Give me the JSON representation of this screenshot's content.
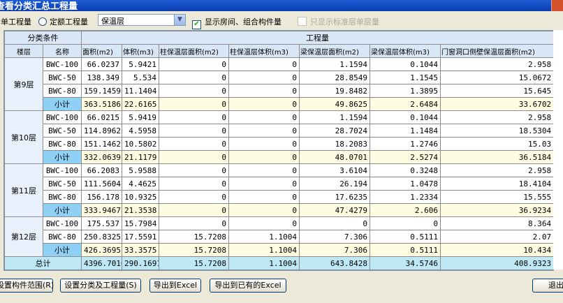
{
  "window": {
    "title": "查看分类汇总工程量"
  },
  "toolbar": {
    "radio1": "清单工程量",
    "radio2": "定额工程量",
    "select_value": "保温层",
    "check1": "显示房间、组合构件量",
    "check2": "只显示标准层单层量"
  },
  "table": {
    "group_left": "分类条件",
    "group_right": "工程量",
    "columns": [
      "楼层",
      "名称",
      "面积(m2)",
      "体积(m3)",
      "柱保温层面积(m2)",
      "柱保温层体积(m3)",
      "梁保温层面积(m2)",
      "梁保温层体积(m3)",
      "门窗洞口侧壁保温层面积(m2)"
    ],
    "subtotal_label": "小计",
    "total_label": "总计",
    "floors": [
      {
        "floor": "第9层",
        "rows": [
          [
            "BWC-100",
            "66.0237",
            "5.9421",
            "0",
            "0",
            "1.1594",
            "0.1044",
            "2.958"
          ],
          [
            "BWC-50",
            "138.349",
            "5.534",
            "0",
            "0",
            "28.8549",
            "1.1545",
            "15.0672"
          ],
          [
            "BWC-80",
            "159.1459",
            "11.1404",
            "0",
            "0",
            "19.8482",
            "1.3895",
            "15.645"
          ]
        ],
        "subtotal": [
          "363.5186",
          "22.6165",
          "0",
          "0",
          "49.8625",
          "2.6484",
          "33.6702"
        ]
      },
      {
        "floor": "第10层",
        "rows": [
          [
            "BWC-100",
            "66.0215",
            "5.9419",
            "0",
            "0",
            "1.1594",
            "0.1044",
            "2.958"
          ],
          [
            "BWC-50",
            "114.8962",
            "4.5958",
            "0",
            "0",
            "28.7024",
            "1.1484",
            "18.5304"
          ],
          [
            "BWC-80",
            "151.1462",
            "10.5802",
            "0",
            "0",
            "18.2083",
            "1.2746",
            "15.03"
          ]
        ],
        "subtotal": [
          "332.0639",
          "21.1179",
          "0",
          "0",
          "48.0701",
          "2.5274",
          "36.5184"
        ]
      },
      {
        "floor": "第11层",
        "rows": [
          [
            "BWC-100",
            "66.2083",
            "5.9588",
            "0",
            "0",
            "3.6104",
            "0.3248",
            "2.958"
          ],
          [
            "BWC-50",
            "111.5604",
            "4.4625",
            "0",
            "0",
            "26.194",
            "1.0478",
            "18.4104"
          ],
          [
            "BWC-80",
            "156.178",
            "10.9325",
            "0",
            "0",
            "17.6235",
            "1.2334",
            "15.555"
          ]
        ],
        "subtotal": [
          "333.9467",
          "21.3538",
          "0",
          "0",
          "47.4279",
          "2.606",
          "36.9234"
        ]
      },
      {
        "floor": "第12层",
        "rows": [
          [
            "BWC-100",
            "175.537",
            "15.7984",
            "0",
            "0",
            "0",
            "0",
            "8.364"
          ],
          [
            "BWC-80",
            "250.8325",
            "17.5591",
            "15.7208",
            "1.1004",
            "7.306",
            "0.5111",
            "2.07"
          ]
        ],
        "subtotal": [
          "426.3695",
          "33.3575",
          "15.7208",
          "1.1004",
          "7.306",
          "0.5111",
          "10.434"
        ]
      }
    ],
    "total": [
      "4396.7016",
      "290.1691",
      "15.7208",
      "1.1004",
      "643.8428",
      "34.5746",
      "408.9323"
    ]
  },
  "buttons": {
    "range": "设置构件范围(R)",
    "set_class": "设置分类及工程量(S)",
    "export": "导出到Excel",
    "export_existing": "导出到已有的Excel",
    "exit": "退出"
  }
}
